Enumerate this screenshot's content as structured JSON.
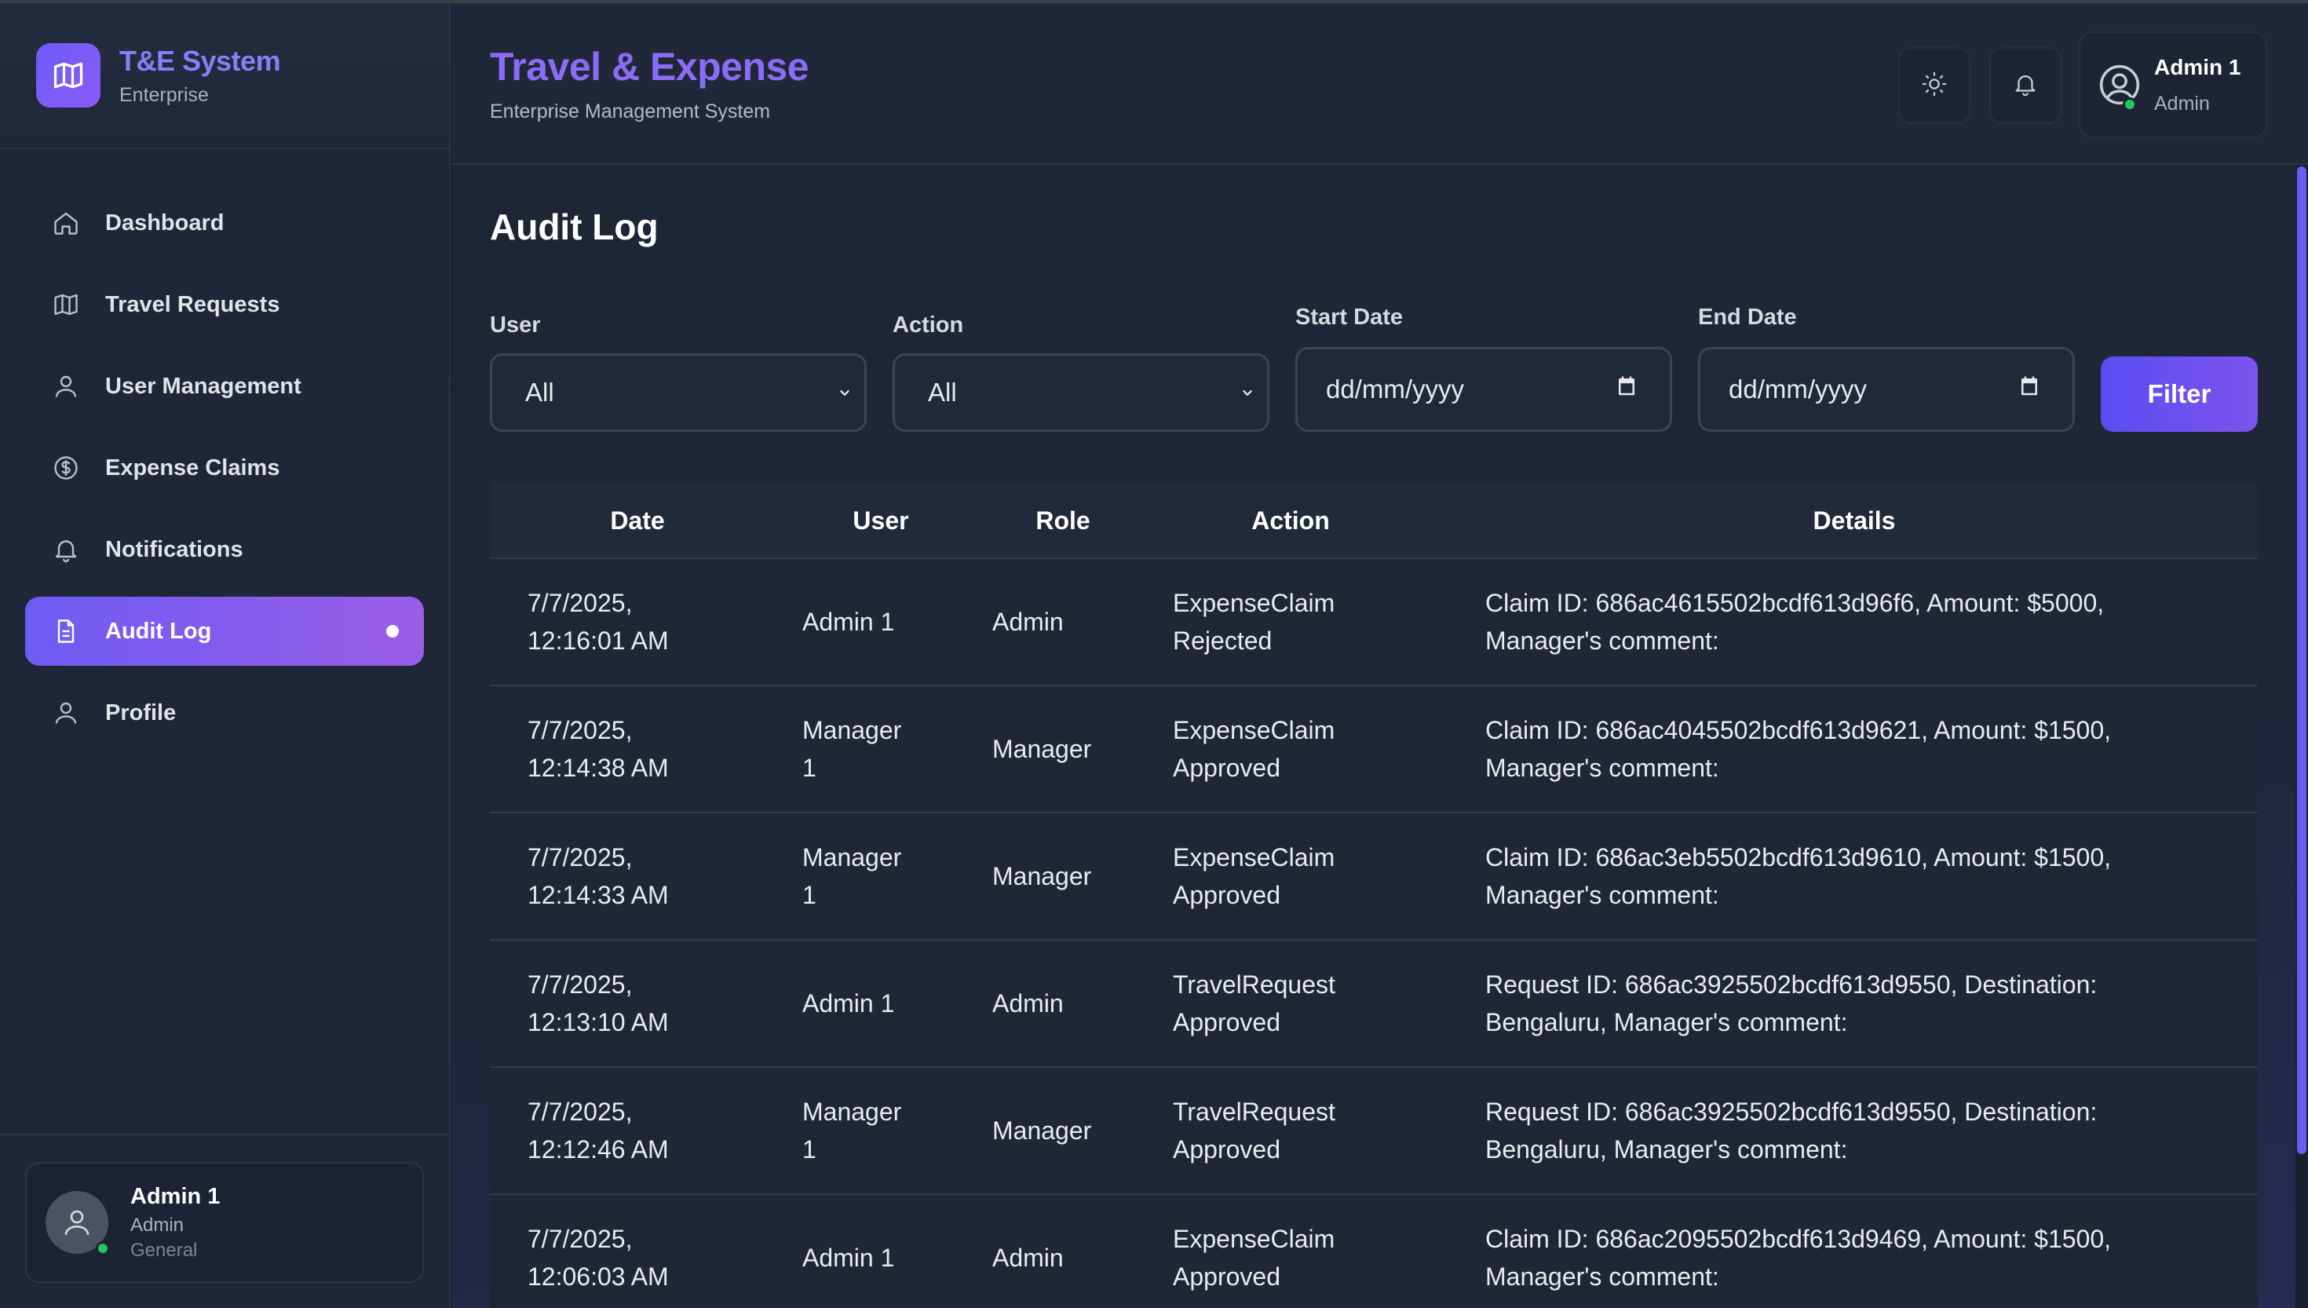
{
  "brand": {
    "title": "T&E System",
    "subtitle": "Enterprise"
  },
  "sidebar": {
    "items": [
      {
        "label": "Dashboard",
        "icon": "home-icon"
      },
      {
        "label": "Travel Requests",
        "icon": "map-icon"
      },
      {
        "label": "User Management",
        "icon": "user-icon"
      },
      {
        "label": "Expense Claims",
        "icon": "dollar-icon"
      },
      {
        "label": "Notifications",
        "icon": "bell-icon"
      },
      {
        "label": "Audit Log",
        "icon": "document-icon",
        "active": true
      },
      {
        "label": "Profile",
        "icon": "user-icon"
      }
    ],
    "user": {
      "name": "Admin 1",
      "role": "Admin",
      "department": "General"
    }
  },
  "header": {
    "title": "Travel & Expense",
    "subtitle": "Enterprise Management System",
    "user": {
      "name": "Admin 1",
      "role": "Admin"
    }
  },
  "page": {
    "title": "Audit Log"
  },
  "filters": {
    "user": {
      "label": "User",
      "value": "All"
    },
    "action": {
      "label": "Action",
      "value": "All"
    },
    "start_date": {
      "label": "Start Date",
      "placeholder": "dd/mm/yyyy"
    },
    "end_date": {
      "label": "End Date",
      "placeholder": "dd/mm/yyyy"
    },
    "button": "Filter"
  },
  "table": {
    "headers": {
      "date": "Date",
      "user": "User",
      "role": "Role",
      "action": "Action",
      "details": "Details"
    },
    "rows": [
      {
        "date_line1": "7/7/2025,",
        "date_line2": "12:16:01 AM",
        "user_line1": "Admin 1",
        "user_line2": "",
        "role": "Admin",
        "action_line1": "ExpenseClaim",
        "action_line2": "Rejected",
        "details_line1": "Claim ID: 686ac4615502bcdf613d96f6, Amount: $5000,",
        "details_line2": "Manager's comment:"
      },
      {
        "date_line1": "7/7/2025,",
        "date_line2": "12:14:38 AM",
        "user_line1": "Manager",
        "user_line2": "1",
        "role": "Manager",
        "action_line1": "ExpenseClaim",
        "action_line2": "Approved",
        "details_line1": "Claim ID: 686ac4045502bcdf613d9621, Amount: $1500,",
        "details_line2": "Manager's comment:"
      },
      {
        "date_line1": "7/7/2025,",
        "date_line2": "12:14:33 AM",
        "user_line1": "Manager",
        "user_line2": "1",
        "role": "Manager",
        "action_line1": "ExpenseClaim",
        "action_line2": "Approved",
        "details_line1": "Claim ID: 686ac3eb5502bcdf613d9610, Amount: $1500,",
        "details_line2": "Manager's comment:"
      },
      {
        "date_line1": "7/7/2025,",
        "date_line2": "12:13:10 AM",
        "user_line1": "Admin 1",
        "user_line2": "",
        "role": "Admin",
        "action_line1": "TravelRequest",
        "action_line2": "Approved",
        "details_line1": "Request ID: 686ac3925502bcdf613d9550, Destination:",
        "details_line2": "Bengaluru, Manager's comment:"
      },
      {
        "date_line1": "7/7/2025,",
        "date_line2": "12:12:46 AM",
        "user_line1": "Manager",
        "user_line2": "1",
        "role": "Manager",
        "action_line1": "TravelRequest",
        "action_line2": "Approved",
        "details_line1": "Request ID: 686ac3925502bcdf613d9550, Destination:",
        "details_line2": "Bengaluru, Manager's comment:"
      },
      {
        "date_line1": "7/7/2025,",
        "date_line2": "12:06:03 AM",
        "user_line1": "Admin 1",
        "user_line2": "",
        "role": "Admin",
        "action_line1": "ExpenseClaim",
        "action_line2": "Approved",
        "details_line1": "Claim ID: 686ac2095502bcdf613d9469, Amount: $1500,",
        "details_line2": "Manager's comment:"
      }
    ]
  },
  "colors": {
    "accent": "#7c5cf4",
    "background": "#1b2233",
    "online": "#22c55e"
  }
}
